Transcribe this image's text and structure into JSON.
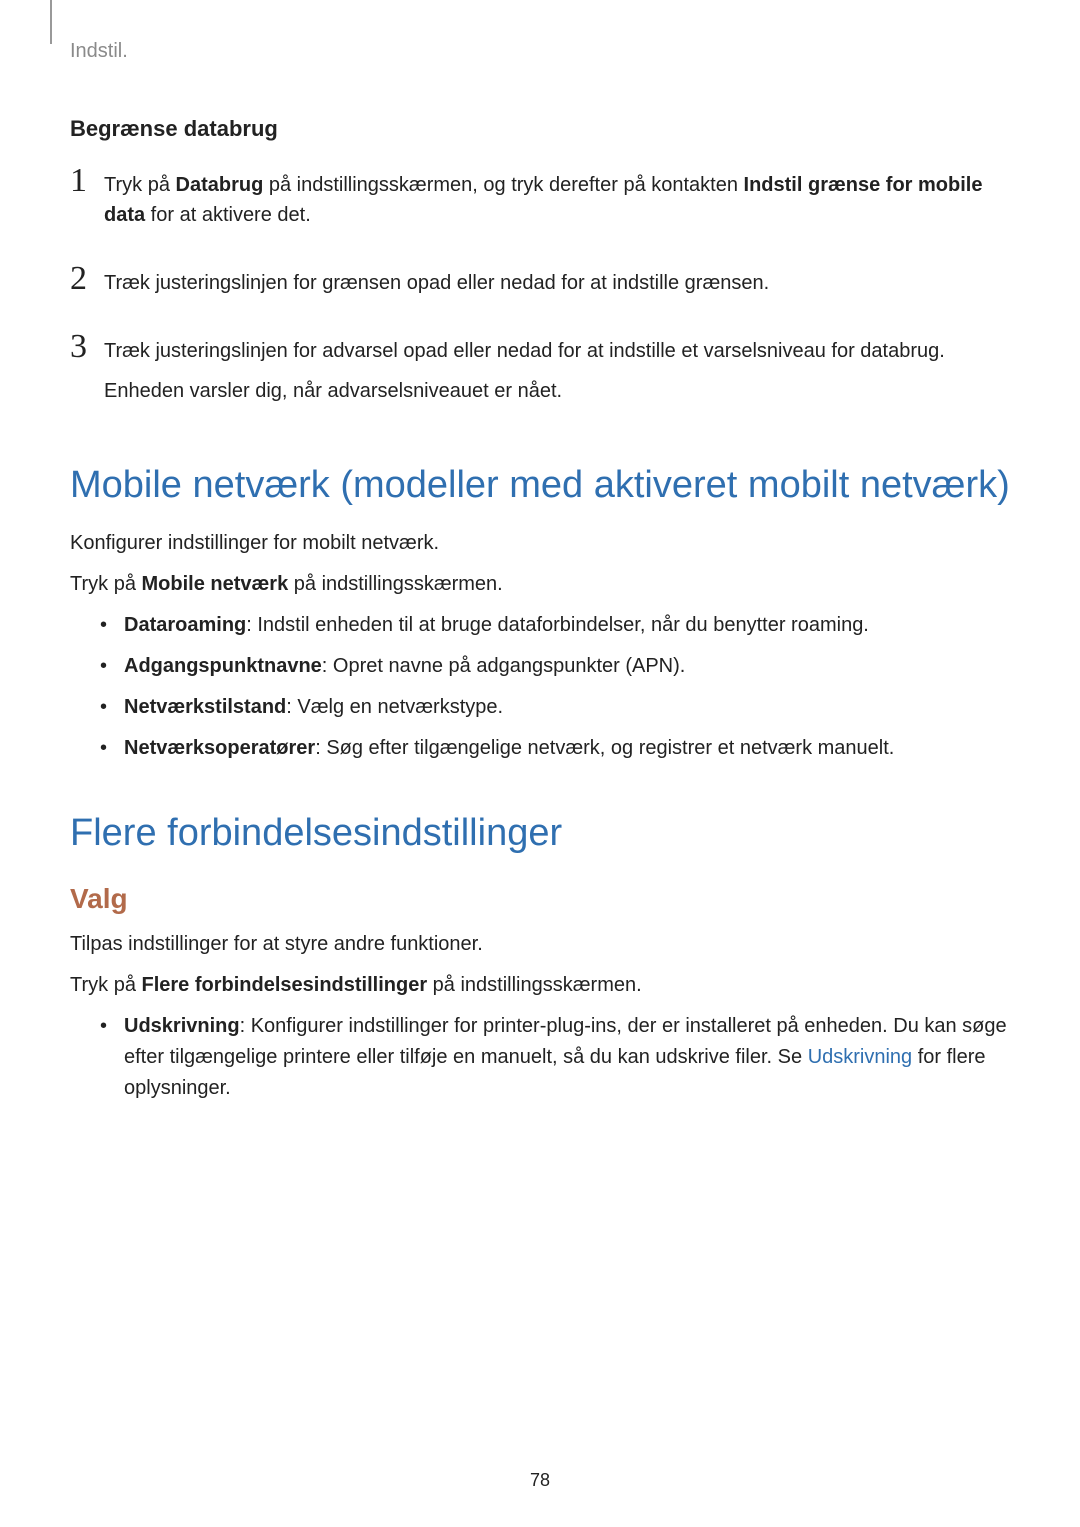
{
  "header": {
    "breadcrumb": "Indstil."
  },
  "section1": {
    "title": "Begrænse databrug",
    "steps": [
      {
        "num": "1",
        "pre": "Tryk på ",
        "bold1": "Databrug",
        "mid": " på indstillingsskærmen, og tryk derefter på kontakten ",
        "bold2": "Indstil grænse for mobile data",
        "post": " for at aktivere det."
      },
      {
        "num": "2",
        "text": "Træk justeringslinjen for grænsen opad eller nedad for at indstille grænsen."
      },
      {
        "num": "3",
        "line1": "Træk justeringslinjen for advarsel opad eller nedad for at indstille et varselsniveau for databrug.",
        "line2": "Enheden varsler dig, når advarselsniveauet er nået."
      }
    ]
  },
  "section2": {
    "title": "Mobile netværk (modeller med aktiveret mobilt netværk)",
    "p1": "Konfigurer indstillinger for mobilt netværk.",
    "p2_pre": "Tryk på ",
    "p2_bold": "Mobile netværk",
    "p2_post": " på indstillingsskærmen.",
    "bullets": [
      {
        "bold": "Dataroaming",
        "rest": ": Indstil enheden til at bruge dataforbindelser, når du benytter roaming."
      },
      {
        "bold": "Adgangspunktnavne",
        "rest": ": Opret navne på adgangspunkter (APN)."
      },
      {
        "bold": "Netværkstilstand",
        "rest": ": Vælg en netværkstype."
      },
      {
        "bold": "Netværksoperatører",
        "rest": ": Søg efter tilgængelige netværk, og registrer et netværk manuelt."
      }
    ]
  },
  "section3": {
    "title": "Flere forbindelsesindstillinger",
    "sub": "Valg",
    "p1": "Tilpas indstillinger for at styre andre funktioner.",
    "p2_pre": "Tryk på ",
    "p2_bold": "Flere forbindelsesindstillinger",
    "p2_post": " på indstillingsskærmen.",
    "bullet": {
      "bold": "Udskrivning",
      "rest1": ": Konfigurer indstillinger for printer-plug-ins, der er installeret på enheden. Du kan søge efter tilgængelige printere eller tilføje en manuelt, så du kan udskrive filer. Se ",
      "link": "Udskrivning",
      "rest2": " for flere oplysninger."
    }
  },
  "page_number": "78"
}
